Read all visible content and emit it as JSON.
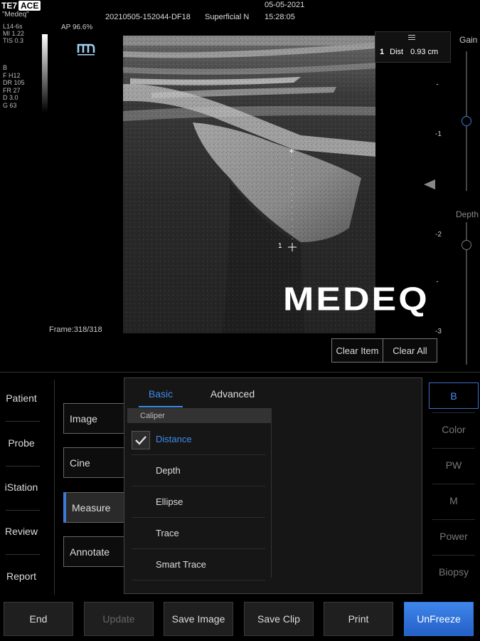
{
  "header": {
    "brand": "TE7",
    "brand_badge": "ACE",
    "site_name": "\"Medeq\"",
    "probe_params": [
      "L14-6s",
      "MI 1.22",
      "TIS 0.3"
    ],
    "acoustic_power": "AP 96.6%",
    "image_params": [
      "B",
      "F H12",
      "DR 105",
      "FR 27",
      "D 3.0",
      "G 63"
    ],
    "exam_id": "20210505-152044-DF18",
    "preset": "Superficial N",
    "date": "05-05-2021",
    "time": "15:28:05"
  },
  "image": {
    "frame": "Frame:318/318",
    "watermark": "MEDEQ",
    "caliper_label": "1",
    "result": {
      "index": "1",
      "name": "Dist",
      "value": "0.93 cm"
    }
  },
  "right_scale": {
    "gain_label": "Gain",
    "depth_label": "Depth",
    "depth_ticks": [
      "1",
      "2",
      "3"
    ]
  },
  "measure_actions": {
    "clear_item": "Clear Item",
    "clear_all": "Clear All"
  },
  "nav": {
    "items": [
      "Patient",
      "Probe",
      "iStation",
      "Review",
      "Report"
    ]
  },
  "functions": {
    "items": [
      "Image",
      "Cine",
      "Measure",
      "Annotate"
    ],
    "active": "Measure"
  },
  "measure_panel": {
    "tabs": [
      "Basic",
      "Advanced"
    ],
    "active_tab": "Basic",
    "section": "Caliper",
    "items": [
      "Distance",
      "Depth",
      "Ellipse",
      "Trace",
      "Smart Trace"
    ],
    "selected": "Distance"
  },
  "modes": {
    "items": [
      "B",
      "Color",
      "PW",
      "M",
      "Power",
      "Biopsy"
    ],
    "active": "B"
  },
  "bottom_bar": {
    "end": "End",
    "update": "Update",
    "save_image": "Save Image",
    "save_clip": "Save Clip",
    "print": "Print",
    "unfreeze": "UnFreeze"
  },
  "colors": {
    "accent": "#3d8be8",
    "primary_button": "#2f73de"
  }
}
